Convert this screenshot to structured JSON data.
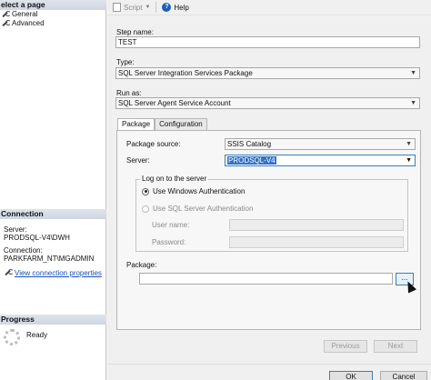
{
  "left": {
    "select_page_header": "elect a page",
    "nav_items": [
      "General",
      "Advanced"
    ],
    "connection_header": "Connection",
    "server_label": "Server:",
    "server_value": "PRODSQL-V4\\DWH",
    "connection_label": "Connection:",
    "connection_value": "PARKFARM_NT\\MGADMIN",
    "view_props_link": "View connection properties",
    "progress_header": "Progress",
    "progress_status": "Ready"
  },
  "toolbar": {
    "script_label": "Script",
    "help_label": "Help"
  },
  "form": {
    "step_name_label": "Step name:",
    "step_name_value": "TEST",
    "type_label": "Type:",
    "type_value": "SQL Server Integration Services Package",
    "run_as_label": "Run as:",
    "run_as_value": "SQL Server Agent Service Account"
  },
  "tabs": [
    "Package",
    "Configuration"
  ],
  "package_tab": {
    "package_source_label": "Package source:",
    "package_source_value": "SSIS Catalog",
    "server_label": "Server:",
    "server_value": "PRODSQL-V4",
    "logon_group_title": "Log on to the server",
    "windows_auth_label": "Use Windows Authentication",
    "sql_auth_label": "Use SQL Server Authentication",
    "user_name_label": "User name:",
    "password_label": "Password:",
    "package_label": "Package:",
    "package_value": "",
    "browse_label": "..."
  },
  "buttons": {
    "previous": "Previous",
    "next": "Next",
    "ok": "OK",
    "cancel": "Cancel"
  },
  "icons": {
    "help": "help-icon",
    "script": "script-icon",
    "nav": "wrench-icon",
    "progress": "spinner-icon"
  }
}
